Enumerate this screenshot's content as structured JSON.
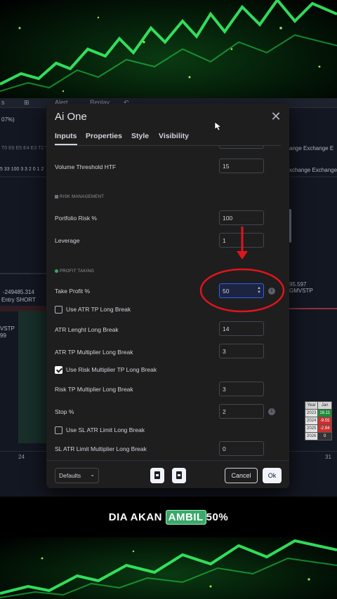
{
  "dialog": {
    "title": "Ai One",
    "tabs": [
      "Inputs",
      "Properties",
      "Style",
      "Visibility"
    ]
  },
  "inputs": {
    "volume_threshold_htf": {
      "label": "Volume Threshold HTF",
      "value": "15"
    },
    "section_risk": "RISK MANAGEMENT",
    "portfolio_risk": {
      "label": "Portfolio Risk %",
      "value": "100"
    },
    "leverage": {
      "label": "Leverage",
      "value": "1"
    },
    "section_profit": "PROFIT TAKING",
    "take_profit": {
      "label": "Take Profit %",
      "value": "50"
    },
    "use_atr_tp": {
      "label": "Use ATR TP Long Break",
      "checked": false
    },
    "atr_length": {
      "label": "ATR Lenght Long Break",
      "value": "14"
    },
    "atr_tp_mult": {
      "label": "ATR TP Multiplier Long Break",
      "value": "3"
    },
    "use_risk_mult": {
      "label": "Use Risk Multiplier TP Long Break",
      "checked": true
    },
    "risk_tp_mult": {
      "label": "Risk TP Multiplier Long Break",
      "value": "3"
    },
    "stop": {
      "label": "Stop %",
      "value": "2"
    },
    "use_sl_atr": {
      "label": "Use SL ATR Limit Long Break",
      "checked": false
    },
    "sl_atr_mult": {
      "label": "SL ATR Limit Multiplier Long Break",
      "value": "0"
    }
  },
  "footer": {
    "defaults": "Defaults",
    "cancel": "Cancel",
    "ok": "Ok"
  },
  "background": {
    "toolbar_left": "s",
    "toolbar_alert": "Alert",
    "toolbar_replay": "Replay",
    "left_texts": [
      "07%)",
      "T0 E6 E5 E4 E3 T2 T1",
      "5 33 100 3 3 2 0 1 2",
      "-249485.314",
      "Entry SHORT",
      "VSTP",
      "99"
    ],
    "right_texts": [
      "ange Exchange E",
      "xchange Exchange",
      "95.597",
      "GMVSTP"
    ],
    "bottom_left": "24",
    "bottom_right": "31",
    "perf_table": {
      "headers": [
        "Year",
        "Jan"
      ],
      "rows": [
        {
          "year": "2023",
          "value": "16.11"
        },
        {
          "year": "2024",
          "value": "-9.55"
        },
        {
          "year": "2025",
          "value": "-2.94"
        },
        {
          "year": "2026",
          "value": "0"
        }
      ]
    }
  },
  "caption": {
    "before": "DIA AKAN ",
    "highlight": "AMBIL",
    "after": "50%"
  },
  "colors": {
    "dialog_bg": "#1e1e1e",
    "focus_blue": "#2962ff",
    "annotation_red": "#e0141e",
    "caption_green": "#3aa86b"
  }
}
